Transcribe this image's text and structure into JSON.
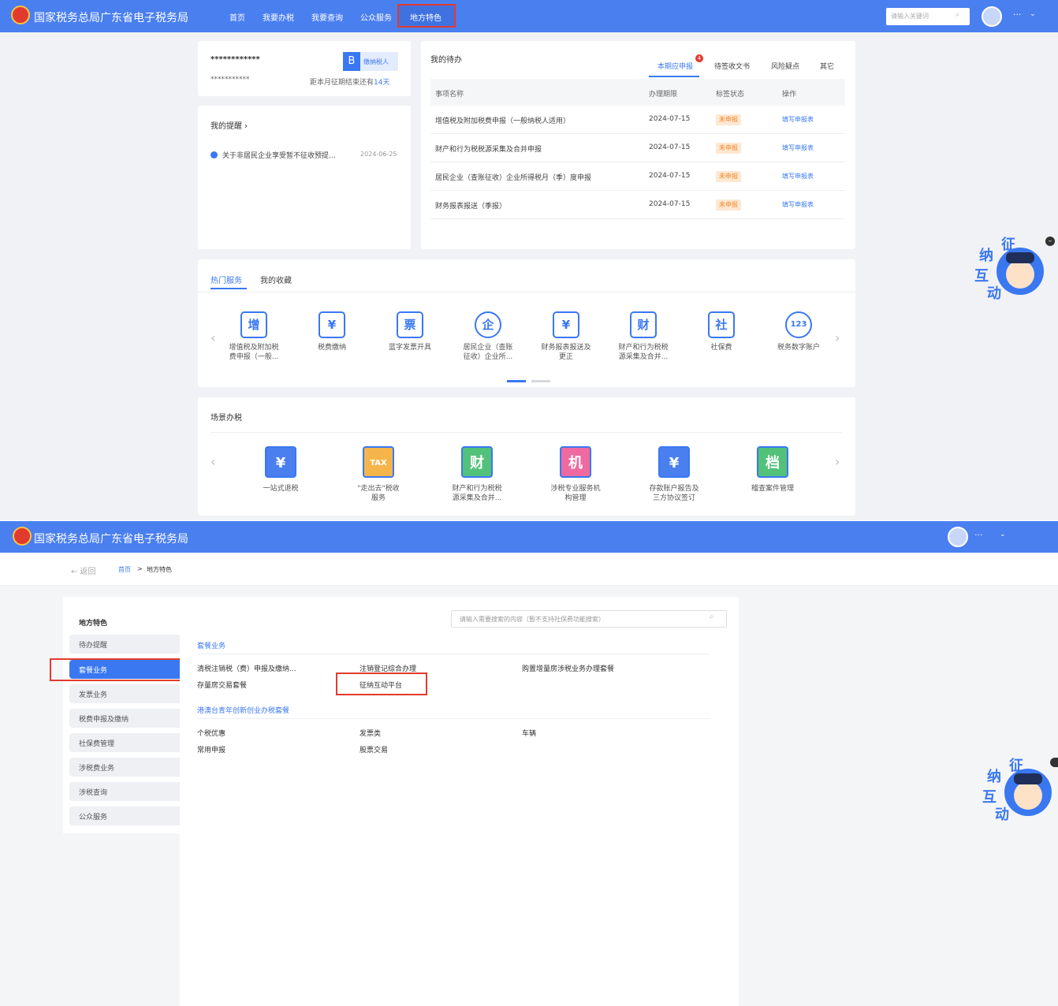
{
  "brand": {
    "title": "国家税务总局广东省电子税务局"
  },
  "screen1": {
    "nav": [
      "首页",
      "我要办税",
      "我要查询",
      "公众服务",
      "地方特色"
    ],
    "search_placeholder": "请输入关键词",
    "more": "···",
    "user": {
      "name": "************",
      "sub": "***********",
      "badge_letter": "B",
      "badge_text": "缴纳税人",
      "deadline_prefix": "距本月征期结束还有",
      "deadline_days": "14天"
    },
    "reminders": {
      "title": "我的提醒 ›",
      "item": "关于非居民企业享受暂不征收预提...",
      "date": "2024-06-25"
    },
    "todo": {
      "title": "我的待办",
      "tabs": [
        "本期应申报",
        "待签收文书",
        "风险疑点",
        "其它"
      ],
      "tab_badge": "4",
      "columns": [
        "事项名称",
        "办理期限",
        "标签状态",
        "操作"
      ],
      "rows": [
        {
          "name": "增值税及附加税费申报（一般纳税人适用）",
          "date": "2024-07-15",
          "status": "未申报",
          "action": "填写申报表"
        },
        {
          "name": "财产和行为税税源采集及合并申报",
          "date": "2024-07-15",
          "status": "未申报",
          "action": "填写申报表"
        },
        {
          "name": "居民企业（查账征收）企业所得税月（季）度申报",
          "date": "2024-07-15",
          "status": "未申报",
          "action": "填写申报表"
        },
        {
          "name": "财务报表报送（季报）",
          "date": "2024-07-15",
          "status": "未申报",
          "action": "填写申报表"
        }
      ]
    },
    "services": {
      "tabs": [
        "热门服务",
        "我的收藏"
      ],
      "items": [
        {
          "icon": "增",
          "label": "增值税及附加税\n费申报（一般..."
        },
        {
          "icon": "¥",
          "label": "税费缴纳"
        },
        {
          "icon": "票",
          "label": "蓝字发票开具"
        },
        {
          "icon": "企",
          "label": "居民企业（查账\n征收）企业所..."
        },
        {
          "icon": "¥",
          "label": "财务报表报送及\n更正"
        },
        {
          "icon": "财",
          "label": "财产和行为税税\n源采集及合并..."
        },
        {
          "icon": "社",
          "label": "社保费"
        },
        {
          "icon": "123",
          "label": "税务数字账户"
        }
      ]
    },
    "scenes": {
      "title": "场景办税",
      "items": [
        {
          "icon": "¥",
          "label": "一站式退税",
          "color": "#4a7ff0"
        },
        {
          "icon": "TAX",
          "label": "\"走出去\"税收\n服务",
          "color": "#f5b54a"
        },
        {
          "icon": "财",
          "label": "财产和行为税税\n源采集及合并...",
          "color": "#52c27a"
        },
        {
          "icon": "机",
          "label": "涉税专业服务机\n构管理",
          "color": "#ee6aa0"
        },
        {
          "icon": "¥",
          "label": "存款账户报告及\n三方协议签订",
          "color": "#4a7ff0"
        },
        {
          "icon": "档",
          "label": "稽查案件管理",
          "color": "#52c27a"
        }
      ]
    },
    "mascot": [
      "征",
      "纳",
      "互",
      "动"
    ]
  },
  "screen2": {
    "back": "← 返回",
    "breadcrumb": {
      "home": "首页",
      "sep": ">",
      "current": "地方特色"
    },
    "sidebar": {
      "title": "地方特色",
      "items": [
        "待办提醒",
        "套餐业务",
        "发票业务",
        "税费申报及缴纳",
        "社保费管理",
        "涉税费业务",
        "涉税查询",
        "公众服务"
      ]
    },
    "search_placeholder": "请输入需要搜索的内容（暂不支持社保费功能搜索）",
    "section1": {
      "title": "套餐业务",
      "links": [
        "清税注销税（费）申报及缴纳...",
        "注销登记综合办理",
        "购置增量房涉税业务办理套餐",
        "存量房交易套餐",
        "征纳互动平台"
      ]
    },
    "section2": {
      "title": "港澳台青年创新创业办税套餐",
      "links": [
        "个税优惠",
        "发票类",
        "车辆",
        "常用申报",
        "股票交易"
      ]
    },
    "more": "···"
  }
}
